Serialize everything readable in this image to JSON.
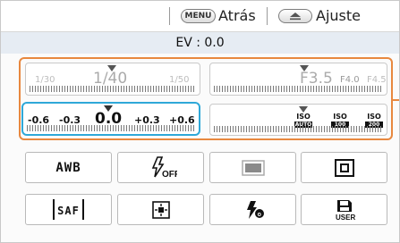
{
  "topbar": {
    "menu_key": "MENU",
    "back_label": "Atrás",
    "adjust_label": "Ajuste",
    "adjust_icon": "eject-up-icon"
  },
  "ev_readout": "EV : 0.0",
  "shutter": {
    "left": "1/30",
    "current": "1/40",
    "right": "1/50"
  },
  "aperture": {
    "current": "F3.5",
    "next": "F4.0",
    "next2": "F4.5"
  },
  "ev_comp": {
    "values": [
      "-0.6",
      "-0.3",
      "0.0",
      "+0.3",
      "+0.6"
    ],
    "selected": "0.0"
  },
  "iso": {
    "icons": [
      {
        "top": "ISO",
        "bottom": "AUTO"
      },
      {
        "top": "ISO",
        "bottom": "100"
      },
      {
        "top": "ISO",
        "bottom": "200"
      }
    ]
  },
  "buttons": {
    "row1": [
      "AWB",
      "flash-off-icon",
      "metering-frame-icon",
      "face-detect-icon"
    ],
    "row2": [
      "SAF",
      "center-af-icon",
      "flash-mode-icon",
      "save-user-icon"
    ],
    "awb_label": "AWB",
    "saf_label": "SAF",
    "flash_off_text": "OFF",
    "user_text": "USER",
    "flash_mode_text": "o"
  },
  "colors": {
    "accent_orange": "#e8883f",
    "accent_blue": "#2fa8d8",
    "band": "#e6ecf3"
  }
}
